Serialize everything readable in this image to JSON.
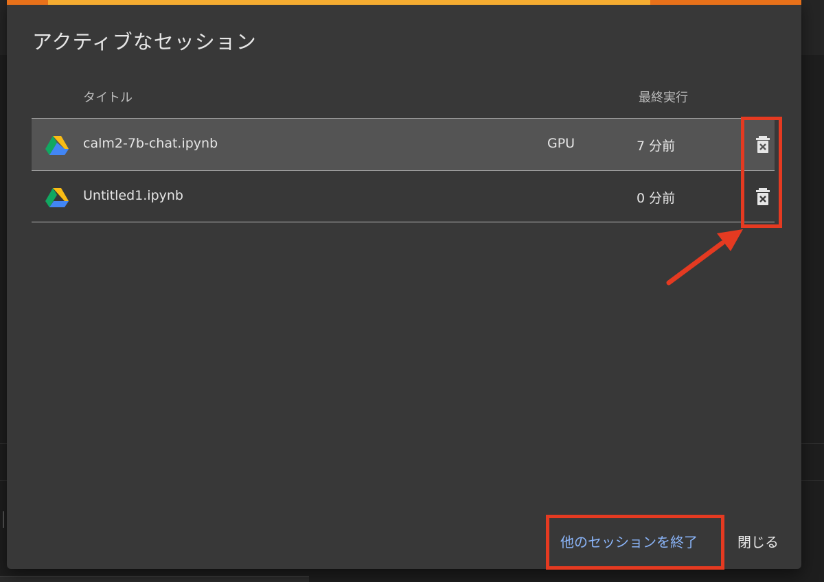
{
  "dialog": {
    "title": "アクティブなセッション",
    "columns": {
      "title": "タイトル",
      "last_run": "最終実行"
    },
    "sessions": [
      {
        "icon": "google-drive-icon",
        "name": "calm2-7b-chat.ipynb",
        "accelerator": "GPU",
        "last_run": "7 分前",
        "delete_icon": "delete-forever-icon",
        "highlighted": true
      },
      {
        "icon": "google-drive-icon",
        "name": "Untitled1.ipynb",
        "accelerator": "",
        "last_run": "0 分前",
        "delete_icon": "delete-forever-icon",
        "highlighted": false
      }
    ],
    "buttons": {
      "terminate_others": "他のセッションを終了",
      "close": "閉じる"
    },
    "progress": 0.81
  },
  "annotations": {
    "color": "#e53a21",
    "items": [
      "delete-buttons-highlight",
      "terminate-button-highlight",
      "arrow-to-delete-buttons"
    ]
  },
  "colors": {
    "dialog_bg": "#383838",
    "row_highlight": "#545454",
    "link_blue": "#8ab4f8",
    "progress_orange": "#e8711a",
    "progress_yellow": "#f5ac31"
  }
}
